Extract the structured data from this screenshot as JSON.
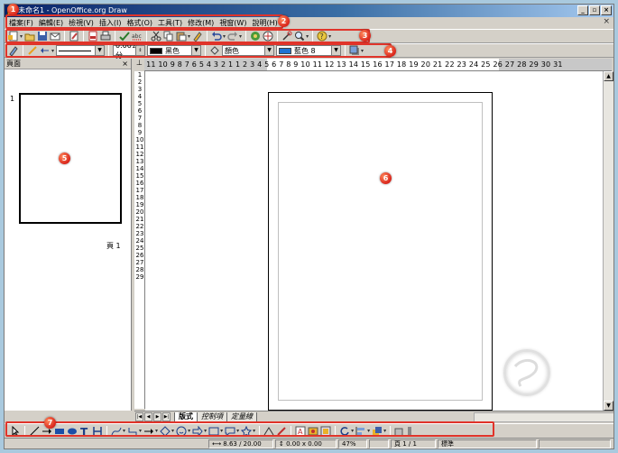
{
  "window": {
    "title": "未命名1 - OpenOffice.org Draw",
    "buttons": {
      "minimize": "_",
      "maximize": "▫",
      "close": "×"
    },
    "doc_close": "×"
  },
  "menu": [
    "檔案(F)",
    "編輯(E)",
    "檢視(V)",
    "插入(I)",
    "格式(O)",
    "工具(T)",
    "修改(M)",
    "視窗(W)",
    "說明(H)"
  ],
  "line_style": {
    "width_value": "0.00公分"
  },
  "line_color": {
    "label": "黑色",
    "color": "#000000"
  },
  "area": {
    "style_label": "顏色",
    "fill_label": "藍色 8",
    "fill_color": "#1c73d4"
  },
  "panels": {
    "pages_title": "頁面",
    "pages_close": "×",
    "thumb_number": "1",
    "thumb_label": "頁 1"
  },
  "ruler": {
    "horizontal": "1 2 11 10 9 8 7 6 5 4 3 2 1     1 2 3 4 5 6 7 8 9 10 11 12 13 14 15 16 17 18 19 20 21 22 23 24 25 26 27 28 29 30 31",
    "vertical": "1 2 3 4 5 6 7 8 9 10 11 12 13 14 15 16 17 18 19 20 21 22 23 24 25 26 27 28 29",
    "corner": "⊥"
  },
  "tabs": [
    "版式",
    "控制項",
    "定量線"
  ],
  "status": {
    "position": "8.63 / 20.00",
    "size": "0.00 x 0.00",
    "zoom": "47%",
    "page": "頁 1 / 1",
    "style": "標準"
  },
  "callouts": [
    "1",
    "2",
    "3",
    "4",
    "5",
    "6",
    "7"
  ],
  "colors": {
    "callout": "#e0342a",
    "titlebar": "#0a246a",
    "background": "#a9c9de"
  }
}
